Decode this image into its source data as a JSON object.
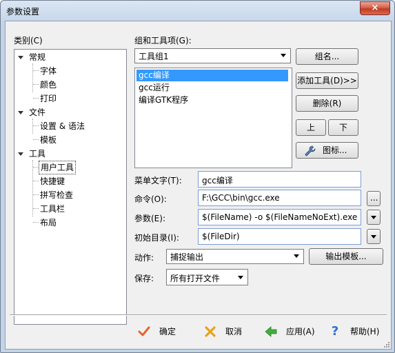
{
  "window": {
    "title": "参数设置",
    "close_symbol": "×"
  },
  "category": {
    "label": "类别(C)"
  },
  "tree": {
    "groups": [
      {
        "label": "常规",
        "children": [
          "字体",
          "颜色",
          "打印"
        ]
      },
      {
        "label": "文件",
        "children": [
          "设置 & 语法",
          "模板"
        ]
      },
      {
        "label": "工具",
        "children": [
          "用户工具",
          "快捷键",
          "拼写检查",
          "工具栏",
          "布局"
        ],
        "selected_child": "用户工具"
      }
    ]
  },
  "group_section": {
    "label": "组和工具项(G):",
    "group_value": "工具组1",
    "items": [
      "gcc编译",
      "gcc运行",
      "编译GTK程序"
    ],
    "selected_item": "gcc编译"
  },
  "side_buttons": {
    "name": "组名...",
    "add_tool": "添加工具(D)>>",
    "delete": "删除(R)",
    "up": "上",
    "down": "下",
    "icon": "图标..."
  },
  "fields": {
    "menu_text": {
      "label": "菜单文字(T):",
      "value": "gcc编译"
    },
    "command": {
      "label": "命令(O):",
      "value": "F:\\GCC\\bin\\gcc.exe",
      "browse": "..."
    },
    "args": {
      "label": "参数(E):",
      "value": "$(FileName) -o $(FileNameNoExt).exe"
    },
    "initdir": {
      "label": "初始目录(I):",
      "value": "$(FileDir)"
    },
    "action": {
      "label": "动作:",
      "value": "捕捉输出",
      "output_template": "输出模板..."
    },
    "save": {
      "label": "保存:",
      "value": "所有打开文件"
    }
  },
  "footer": {
    "ok": "确定",
    "cancel": "取消",
    "apply": "应用(A)",
    "help": "帮助(H)"
  },
  "colors": {
    "ok": "#e8632c",
    "cancel": "#e8a21c",
    "apply": "#3fae3f",
    "help": "#2f6fd6",
    "selection": "#3399ff"
  }
}
